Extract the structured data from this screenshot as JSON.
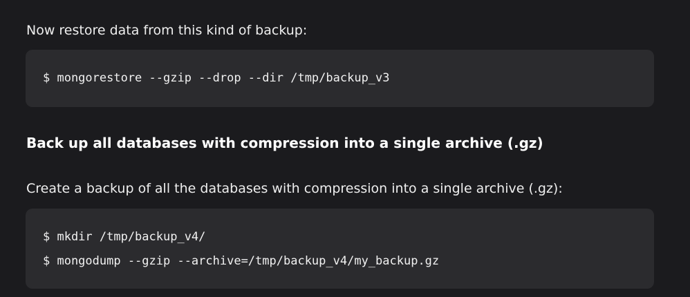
{
  "content": {
    "restore_intro": "Now restore data from this kind of backup:",
    "restore_code": [
      "$ mongorestore --gzip --drop --dir /tmp/backup_v3"
    ],
    "section_heading": "Back up all databases with compression into a single archive (.gz)",
    "section_intro": "Create a backup of all the databases with compression into a single archive (.gz):",
    "backup_code": [
      "$ mkdir /tmp/backup_v4/",
      "$ mongodump --gzip --archive=/tmp/backup_v4/my_backup.gz"
    ]
  }
}
